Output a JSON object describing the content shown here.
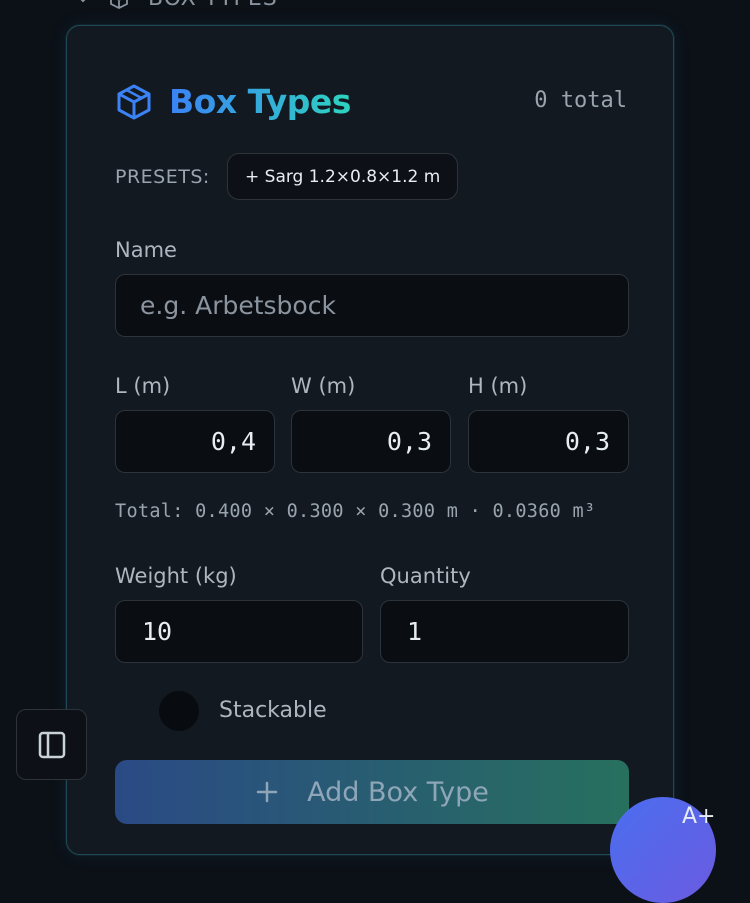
{
  "top": {
    "section_label": "BOX TYPES"
  },
  "header": {
    "title": "Box Types",
    "total": "0 total"
  },
  "presets": {
    "label": "PRESETS:",
    "items": [
      "+ Sarg 1.2×0.8×1.2 m"
    ]
  },
  "form": {
    "name_label": "Name",
    "name_placeholder": "e.g. Arbetsbock",
    "name_value": "",
    "length_label": "L (m)",
    "length_value": "0,4",
    "width_label": "W (m)",
    "width_value": "0,3",
    "height_label": "H (m)",
    "height_value": "0,3",
    "summary": "Total: 0.400 × 0.300 × 0.300 m · 0.0360 m³",
    "weight_label": "Weight (kg)",
    "weight_value": "10",
    "quantity_label": "Quantity",
    "quantity_value": "1",
    "stackable_label": "Stackable",
    "stackable_on": false,
    "add_button_label": "Add Box Type"
  },
  "fab": {
    "glyph": "A+"
  },
  "colors": {
    "accent_blue": "#3b82f6",
    "accent_teal": "#2dd4bf",
    "background": "#0c1118",
    "card": "#121920"
  },
  "icons": [
    "chevron-down-icon",
    "boxes-icon",
    "cube-icon",
    "plus-icon",
    "sidebar-toggle-icon"
  ]
}
